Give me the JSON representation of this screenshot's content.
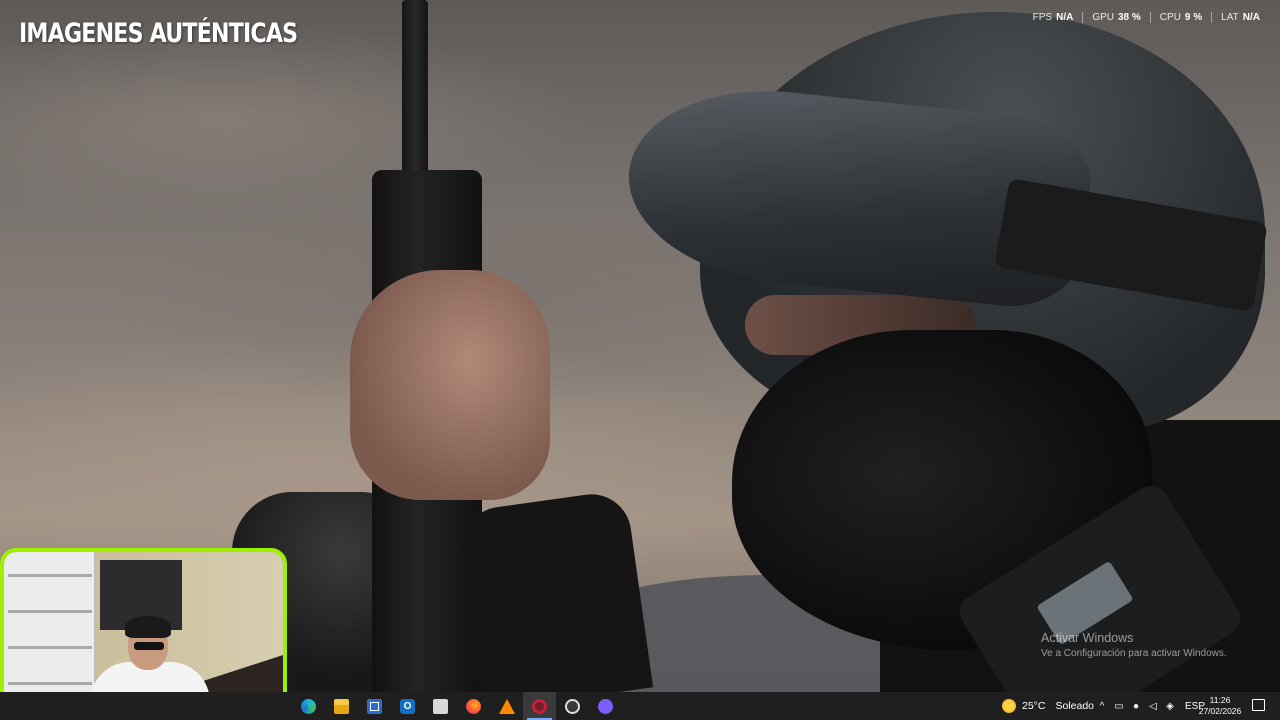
{
  "overlay": {
    "channel_title": "IMAGENES AUTÉNTICAS"
  },
  "perf_stats": [
    {
      "label": "FPS",
      "value": "N/A"
    },
    {
      "label": "GPU",
      "value": "38 %"
    },
    {
      "label": "CPU",
      "value": "9 %"
    },
    {
      "label": "LAT",
      "value": "N/A"
    }
  ],
  "activation": {
    "line1": "Activar Windows",
    "line2": "Ve a Configuración para activar Windows."
  },
  "taskbar": {
    "apps": [
      {
        "name": "edge-icon"
      },
      {
        "name": "file-explorer-icon"
      },
      {
        "name": "store-icon"
      },
      {
        "name": "outlook-icon",
        "glyph": "O"
      },
      {
        "name": "explorer-icon"
      },
      {
        "name": "firefox-icon"
      },
      {
        "name": "vlc-icon"
      },
      {
        "name": "recording-app-icon",
        "active": true
      },
      {
        "name": "obs-icon"
      },
      {
        "name": "discord-icon"
      }
    ],
    "weather": {
      "temp": "25°C",
      "condition": "Soleado"
    },
    "tray": {
      "chevron": "^",
      "language": "ESP"
    },
    "clock": {
      "time": "11:26",
      "date": "27/02/2026"
    }
  },
  "colors": {
    "webcam_border": "#9cf000",
    "taskbar_bg": "#1f1f1f",
    "active_indicator": "#7aa7ff"
  }
}
